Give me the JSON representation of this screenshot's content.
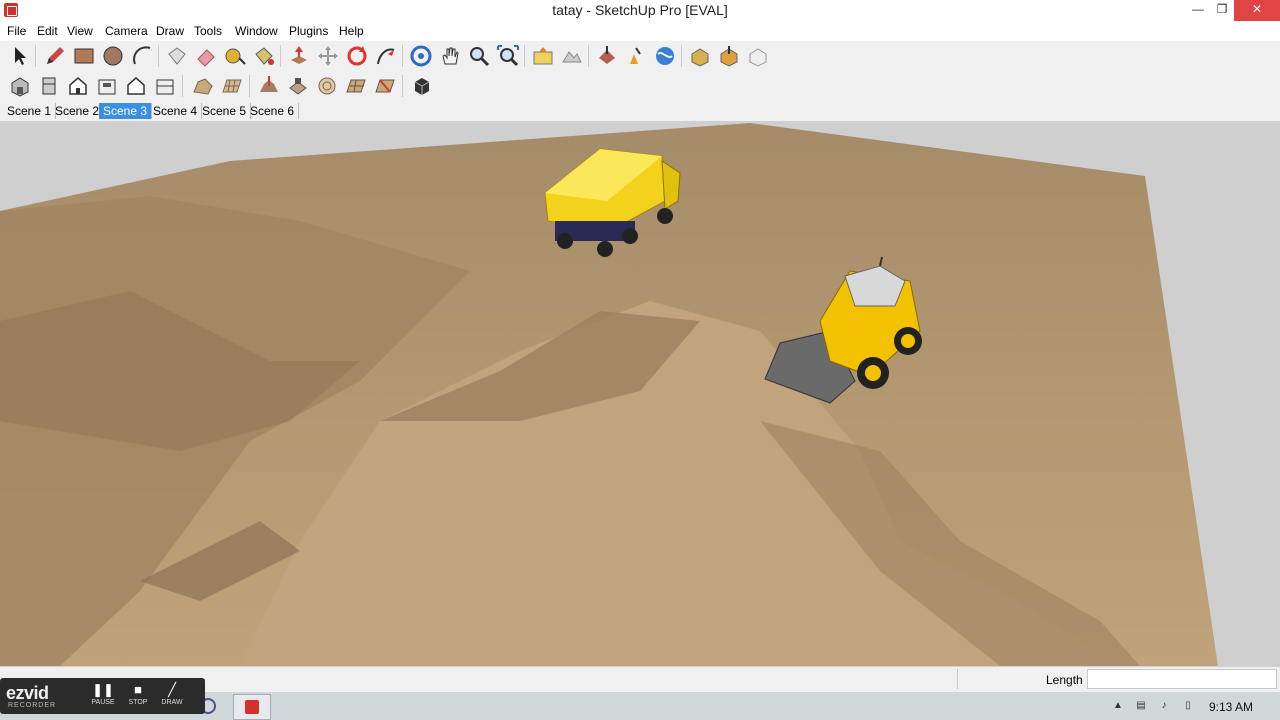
{
  "window": {
    "title": "tatay - SketchUp Pro [EVAL]",
    "minimize_glyph": "—",
    "restore_glyph": "❐",
    "close_glyph": "✕"
  },
  "menu": [
    "File",
    "Edit",
    "View",
    "Camera",
    "Draw",
    "Tools",
    "Window",
    "Plugins",
    "Help"
  ],
  "toolbar_icons_row1": [
    "select-icon",
    "pencil-icon",
    "rectangle-icon",
    "circle-icon",
    "arc-icon",
    "make-component-icon",
    "eraser-icon",
    "tape-measure-icon",
    "paint-bucket-icon",
    "push-pull-icon",
    "move-icon",
    "rotate-icon",
    "follow-me-icon",
    "orbit-icon",
    "pan-icon",
    "zoom-icon",
    "zoom-extents-icon",
    "add-location-icon",
    "terrain-icon",
    "get-models-icon",
    "share-model-icon",
    "google-earth-icon",
    "3d-warehouse-icon",
    "share-component-icon",
    "extension-icon"
  ],
  "toolbar_icons_row2": [
    "iso-view-icon",
    "top-view-icon",
    "front-view-icon",
    "right-view-icon",
    "back-view-icon",
    "left-view-icon",
    "sandbox-contours-icon",
    "sandbox-scratch-icon",
    "smoove-icon",
    "stamp-icon",
    "drape-icon",
    "add-detail-icon",
    "flip-edge-icon",
    "section-icon"
  ],
  "scenes": {
    "tabs": [
      "Scene 1",
      "Scene 2",
      "Scene 3",
      "Scene 4",
      "Scene 5",
      "Scene 6"
    ],
    "active": "Scene 3"
  },
  "statusbar": {
    "measurement_label": "Length",
    "measurement_value": ""
  },
  "ezvid": {
    "logo": "ezvid",
    "subtitle": "RECORDER",
    "pause_label": "PAUSE",
    "stop_label": "STOP",
    "draw_label": "DRAW"
  },
  "taskbar": {
    "clock": "9:13 AM"
  },
  "colors": {
    "terrain": "#b39b78",
    "sky": "#cfcfcf",
    "active_scene": "#3b8fe0",
    "vehicle": "#f2d21a",
    "close_button": "#e04343"
  }
}
